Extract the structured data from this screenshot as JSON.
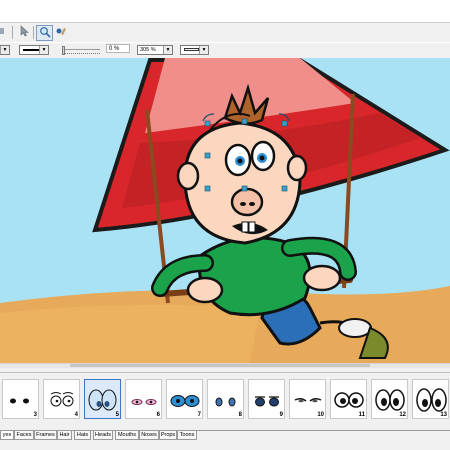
{
  "toolbar": {
    "zoom_percent": "305 %",
    "opacity_value": "0 %",
    "tool_icons": [
      "pointer-icon",
      "zoom-icon",
      "hand-icon"
    ]
  },
  "eye_strip": {
    "cells": [
      {
        "number": "3",
        "icon": "eyes-closed-small"
      },
      {
        "number": "4",
        "icon": "eyes-round-open"
      },
      {
        "number": "5",
        "icon": "eyes-blue-big",
        "selected": true
      },
      {
        "number": "6",
        "icon": "eyes-pink-lashes"
      },
      {
        "number": "7",
        "icon": "eyes-goggle-blue"
      },
      {
        "number": "8",
        "icon": "eyes-small-blue"
      },
      {
        "number": "9",
        "icon": "eyes-dark-lidded"
      },
      {
        "number": "10",
        "icon": "eyes-narrow"
      },
      {
        "number": "11",
        "icon": "eyes-cartoon-round"
      },
      {
        "number": "12",
        "icon": "eyes-tall-oval"
      },
      {
        "number": "13",
        "icon": "eyes-big-oval"
      }
    ]
  },
  "tabs": [
    "yes",
    "Faces",
    "Frames",
    "Hair",
    "Hats",
    "Heads",
    "Mouths",
    "Noses",
    "Props",
    "Toons"
  ],
  "colors": {
    "sky": "#a8e2f4",
    "ground": "#e7a95a",
    "umbrella_red": "#d8262b",
    "shirt_green": "#1aa34a",
    "selection": "#3aa0c8"
  }
}
